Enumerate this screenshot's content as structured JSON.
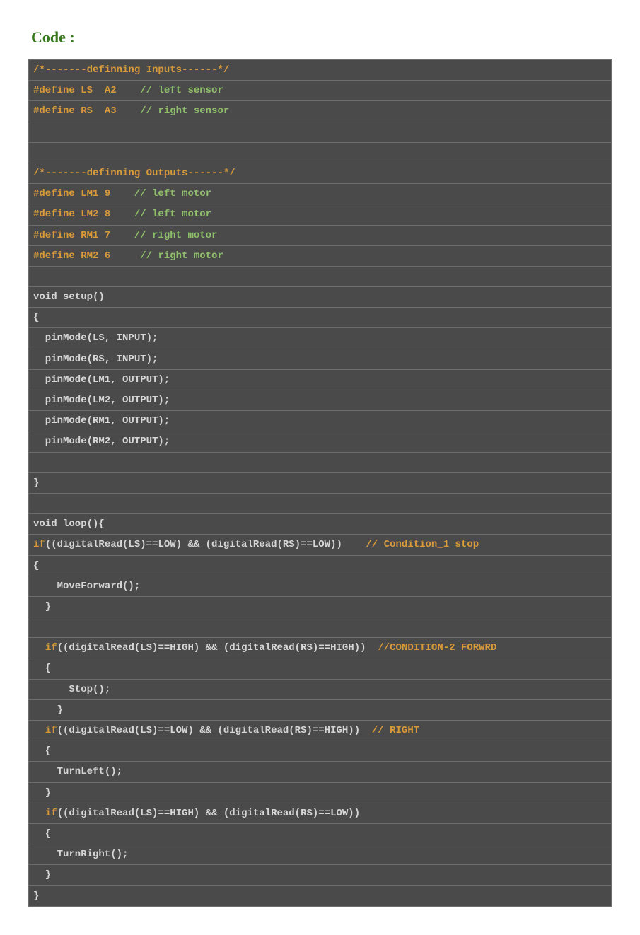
{
  "heading": "Code :",
  "lines": {
    "l1": "<span class='orange'>/*-------definning Inputs------*/</span>",
    "l2": "<span class='orange'>#define LS  A2    </span><span class='green'>// left sensor</span>",
    "l3": "<span class='orange'>#define RS  A3    </span><span class='green'>// right sensor</span>",
    "l4": "&nbsp;",
    "l5": "&nbsp;",
    "l6": "<span class='orange'>/*-------definning Outputs------*/</span>",
    "l7": "<span class='orange'>#define LM1 9    </span><span class='green'>// left motor</span>",
    "l8": "<span class='orange'>#define LM2 8    </span><span class='green'>// left motor</span>",
    "l9": "<span class='orange'>#define RM1 7    </span><span class='green'>// right motor</span>",
    "l10": "<span class='orange'>#define RM2 6     </span><span class='green'>// right motor</span>",
    "l11": "&nbsp;",
    "l12": "<span class='gray'>void setup()</span>",
    "l13": "<span class='gray'>{</span>",
    "l14": "<span class='gray'>  pinMode(LS, INPUT);</span>",
    "l15": "<span class='gray'>  pinMode(RS, INPUT);</span>",
    "l16": "<span class='gray'>  pinMode(LM1, OUTPUT);</span>",
    "l17": "<span class='gray'>  pinMode(LM2, OUTPUT);</span>",
    "l18": "<span class='gray'>  pinMode(RM1, OUTPUT);</span>",
    "l19": "<span class='gray'>  pinMode(RM2, OUTPUT);</span>",
    "l20": "&nbsp;",
    "l21": "<span class='gray'>}</span>",
    "l22": "&nbsp;",
    "l23": "<span class='gray'>void loop(){</span>",
    "l24": "<span class='orange'>if</span><span class='gray'>((digitalRead(LS)==LOW) && (digitalRead(RS)==LOW))    </span><span class='orange'>// Condition_1 stop</span>",
    "l25": "<span class='gray'>{</span>",
    "l26": "<span class='gray'>    MoveForward();</span>",
    "l27": "<span class='gray'>  }</span>",
    "l28": "&nbsp;",
    "l29": "<span class='gray'>  </span><span class='orange'>if</span><span class='gray'>((digitalRead(LS)==HIGH) && (digitalRead(RS)==HIGH))  </span><span class='orange'>//CONDITION-2 FORWRD</span>",
    "l30": "<span class='gray'>  {</span>",
    "l31": "<span class='gray'>      Stop();</span>",
    "l32": "<span class='gray'>    }</span>",
    "l33": "<span class='gray'>  </span><span class='orange'>if</span><span class='gray'>((digitalRead(LS)==LOW) && (digitalRead(RS)==HIGH))  </span><span class='orange'>// RIGHT</span>",
    "l34": "<span class='gray'>  {</span>",
    "l35": "<span class='gray'>    TurnLeft();</span>",
    "l36": "<span class='gray'>  }</span>",
    "l37": "<span class='gray'>  </span><span class='orange'>if</span><span class='gray'>((digitalRead(LS)==HIGH) && (digitalRead(RS)==LOW))</span>",
    "l38": "<span class='gray'>  {</span>",
    "l39": "<span class='gray'>    TurnRight();</span>",
    "l40": "<span class='gray'>  }</span>",
    "l41": "<span class='gray'>}</span>"
  }
}
